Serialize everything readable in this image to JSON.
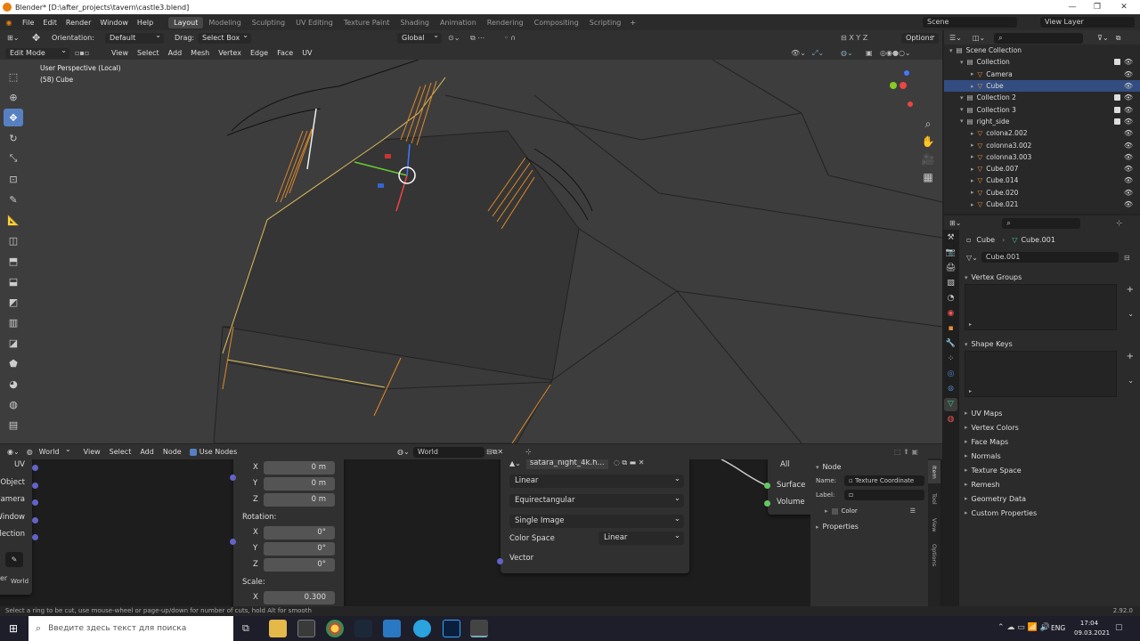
{
  "window": {
    "title": "Blender* [D:\\after_projects\\tavern\\castle3.blend]"
  },
  "menus": [
    "File",
    "Edit",
    "Render",
    "Window",
    "Help"
  ],
  "workspaces": [
    "Layout",
    "Modeling",
    "Sculpting",
    "UV Editing",
    "Texture Paint",
    "Shading",
    "Animation",
    "Rendering",
    "Compositing",
    "Scripting"
  ],
  "active_workspace": "Layout",
  "scene": "Scene",
  "view_layer": "View Layer",
  "tool_header": {
    "orientation_label": "Orientation:",
    "orientation": "Default",
    "drag_label": "Drag:",
    "drag": "Select Box",
    "transform": "Global",
    "options": "Options"
  },
  "editor_header": {
    "mode": "Edit Mode",
    "items": [
      "View",
      "Select",
      "Add",
      "Mesh",
      "Vertex",
      "Edge",
      "Face",
      "UV"
    ]
  },
  "viewport": {
    "info_line1": "User Perspective (Local)",
    "info_line2": "(58) Cube"
  },
  "outliner": {
    "search_placeholder": "",
    "rows": [
      {
        "label": "Scene Collection",
        "indent": 0
      },
      {
        "label": "Collection",
        "indent": 1
      },
      {
        "label": "Camera",
        "indent": 2
      },
      {
        "label": "Cube",
        "indent": 2,
        "selected": true
      },
      {
        "label": "Collection 2",
        "indent": 1
      },
      {
        "label": "Collection 3",
        "indent": 1
      },
      {
        "label": "right_side",
        "indent": 1
      },
      {
        "label": "colona2.002",
        "indent": 2
      },
      {
        "label": "colonna3.002",
        "indent": 2
      },
      {
        "label": "colonna3.003",
        "indent": 2
      },
      {
        "label": "Cube.007",
        "indent": 2
      },
      {
        "label": "Cube.014",
        "indent": 2
      },
      {
        "label": "Cube.020",
        "indent": 2
      },
      {
        "label": "Cube.021",
        "indent": 2
      }
    ]
  },
  "properties": {
    "breadcrumb_obj": "Cube",
    "breadcrumb_mesh": "Cube.001",
    "mesh_name": "Cube.001",
    "panels": {
      "vertex_groups": "Vertex Groups",
      "shape_keys": "Shape Keys"
    },
    "collapsed": [
      "UV Maps",
      "Vertex Colors",
      "Face Maps",
      "Normals",
      "Texture Space",
      "Remesh",
      "Geometry Data",
      "Custom Properties"
    ]
  },
  "node_editor": {
    "header": {
      "type": "World",
      "items": [
        "View",
        "Select",
        "Add",
        "Node"
      ],
      "use_nodes": "Use Nodes",
      "world": "World"
    },
    "left_node_outputs": [
      "UV",
      "Object",
      "Camera",
      "Window",
      "ollection"
    ],
    "left_frame_text": "er",
    "left_world_label": "World",
    "mapping": {
      "fields": [
        {
          "axis": "X",
          "value": "0 m"
        },
        {
          "axis": "Y",
          "value": "0 m"
        },
        {
          "axis": "Z",
          "value": "0 m"
        }
      ],
      "rotation_label": "Rotation:",
      "rotation": [
        {
          "axis": "X",
          "value": "0°"
        },
        {
          "axis": "Y",
          "value": "0°"
        },
        {
          "axis": "Z",
          "value": "0°"
        }
      ],
      "scale_label": "Scale:",
      "scale": [
        {
          "axis": "X",
          "value": "0.300"
        }
      ]
    },
    "env_texture": {
      "image": "satara_night_4k.h...",
      "interpolation": "Linear",
      "projection": "Equirectangular",
      "source": "Single Image",
      "color_space_label": "Color Space",
      "color_space": "Linear",
      "vector": "Vector"
    },
    "output": {
      "target": "All",
      "surface": "Surface",
      "volume": "Volume"
    },
    "sidebar": {
      "title": "Node",
      "name_label": "Name:",
      "name": "Texture Coordinate",
      "label_label": "Label:",
      "color": "Color",
      "properties": "Properties",
      "tabs": [
        "Item",
        "Tool",
        "View",
        "Options"
      ]
    }
  },
  "status": {
    "hint": "Select a ring to be cut, use mouse-wheel or page-up/down for number of cuts, hold Alt for smooth",
    "version": "2.92.0"
  },
  "taskbar": {
    "search_placeholder": "Введите здесь текст для поиска",
    "lang": "ENG",
    "time": "17:04",
    "date": "09.03.2021"
  }
}
